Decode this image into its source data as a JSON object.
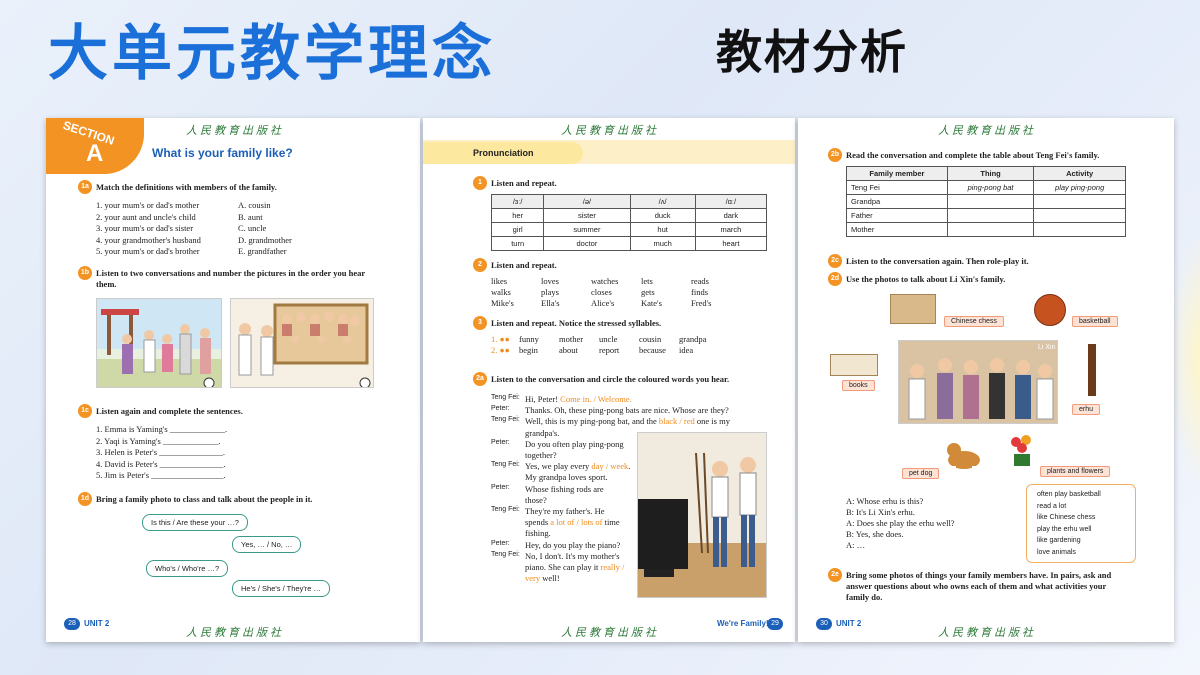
{
  "slide": {
    "title": "大单元教学理念",
    "subtitle": "教材分析"
  },
  "publisher": "人民教育出版社",
  "page1": {
    "section": {
      "word": "SECTION",
      "letter": "A",
      "title": "What is your family like?"
    },
    "ex1a": {
      "num": "1a",
      "instr": "Match the definitions with members of the family.",
      "items": [
        "1. your mum's or dad's mother",
        "2. your aunt and uncle's child",
        "3. your mum's or dad's sister",
        "4. your grandmother's husband",
        "5. your mum's or dad's brother"
      ],
      "options": [
        "A. cousin",
        "B. aunt",
        "C. uncle",
        "D. grandmother",
        "E. grandfather"
      ]
    },
    "ex1b": {
      "num": "1b",
      "instr1": "Listen to two conversations and number the pictures in the order you hear",
      "instr2": "them."
    },
    "ex1c": {
      "num": "1c",
      "instr": "Listen again and complete the sentences.",
      "items": [
        "1. Emma is Yaming's _____________.",
        "2. Yaqi is Yaming's _____________.",
        "3. Helen is Peter's _______________.",
        "4. David is Peter's _______________.",
        "5. Jim is Peter's _________________."
      ]
    },
    "ex1d": {
      "num": "1d",
      "instr": "Bring a family photo to class and talk about the people in it.",
      "bubbles": [
        "Is this / Are these your …?",
        "Yes, … / No, …",
        "Who's / Who're …?",
        "He's / She's / They're …"
      ]
    },
    "footer": {
      "page": "28",
      "unit": "UNIT 2"
    }
  },
  "page2": {
    "pron": "Pronunciation",
    "ex1": {
      "num": "1",
      "instr": "Listen and repeat.",
      "headers": [
        "/ɜː/",
        "/ə/",
        "/ʌ/",
        "/ɑː/"
      ],
      "rows": [
        [
          "her",
          "sister",
          "duck",
          "dark"
        ],
        [
          "girl",
          "summer",
          "hut",
          "march"
        ],
        [
          "turn",
          "doctor",
          "much",
          "heart"
        ]
      ]
    },
    "ex2": {
      "num": "2",
      "instr": "Listen and repeat.",
      "rows": [
        [
          "likes",
          "loves",
          "watches",
          "lets",
          "reads"
        ],
        [
          "walks",
          "plays",
          "closes",
          "gets",
          "finds"
        ],
        [
          "Mike's",
          "Ella's",
          "Alice's",
          "Kate's",
          "Fred's"
        ]
      ]
    },
    "ex3": {
      "num": "3",
      "instr": "Listen and repeat. Notice the stressed syllables.",
      "rows": [
        {
          "n": "1. ●●",
          "w": [
            "funny",
            "mother",
            "uncle",
            "cousin",
            "grandpa"
          ]
        },
        {
          "n": "2. ●●",
          "w": [
            "begin",
            "about",
            "report",
            "because",
            "idea"
          ]
        }
      ]
    },
    "ex2a": {
      "num": "2a",
      "instr": "Listen to the conversation and circle the coloured words you hear.",
      "lines": [
        {
          "sp": "Teng Fei:",
          "parts": [
            {
              "t": "Hi, Peter! "
            },
            {
              "t": "Come in. / Welcome.",
              "o": true
            }
          ]
        },
        {
          "sp": "Peter:",
          "parts": [
            {
              "t": "Thanks. Oh, these ping-pong bats are nice. Whose are they?"
            }
          ]
        },
        {
          "sp": "Teng Fei:",
          "parts": [
            {
              "t": "Well, this is my ping-pong bat, and the "
            },
            {
              "t": "black / red",
              "o": true
            },
            {
              "t": " one is my"
            }
          ]
        },
        {
          "sp": "",
          "parts": [
            {
              "t": "grandpa's."
            }
          ]
        },
        {
          "sp": "Peter:",
          "parts": [
            {
              "t": "Do you often play ping-pong"
            }
          ]
        },
        {
          "sp": "",
          "parts": [
            {
              "t": "together?"
            }
          ]
        },
        {
          "sp": "Teng Fei:",
          "parts": [
            {
              "t": "Yes, we play every "
            },
            {
              "t": "day / week",
              "o": true
            },
            {
              "t": "."
            }
          ]
        },
        {
          "sp": "",
          "parts": [
            {
              "t": "My grandpa loves sport."
            }
          ]
        },
        {
          "sp": "Peter:",
          "parts": [
            {
              "t": "Whose fishing rods are"
            }
          ]
        },
        {
          "sp": "",
          "parts": [
            {
              "t": "those?"
            }
          ]
        },
        {
          "sp": "Teng Fei:",
          "parts": [
            {
              "t": "They're my father's. He"
            }
          ]
        },
        {
          "sp": "",
          "parts": [
            {
              "t": "spends "
            },
            {
              "t": "a lot of / lots of",
              "o": true
            },
            {
              "t": " time"
            }
          ]
        },
        {
          "sp": "",
          "parts": [
            {
              "t": "fishing."
            }
          ]
        },
        {
          "sp": "Peter:",
          "parts": [
            {
              "t": "Hey, do you play the piano?"
            }
          ]
        },
        {
          "sp": "Teng Fei:",
          "parts": [
            {
              "t": "No, I don't. It's my mother's"
            }
          ]
        },
        {
          "sp": "",
          "parts": [
            {
              "t": "piano. She can play it "
            },
            {
              "t": "really /",
              "o": true
            }
          ]
        },
        {
          "sp": "",
          "parts": [
            {
              "t": "very",
              "o": true
            },
            {
              "t": " well!"
            }
          ]
        }
      ]
    },
    "footer": {
      "page": "29",
      "title": "We're Family!"
    }
  },
  "page3": {
    "ex2b": {
      "num": "2b",
      "instr": "Read the conversation and complete the table about Teng Fei's family.",
      "headers": [
        "Family member",
        "Thing",
        "Activity"
      ],
      "rows": [
        [
          "Teng Fei",
          "ping-pong bat",
          "play ping-pong"
        ],
        [
          "Grandpa",
          "",
          ""
        ],
        [
          "Father",
          "",
          ""
        ],
        [
          "Mother",
          "",
          ""
        ]
      ]
    },
    "ex2c": {
      "num": "2c",
      "instr": "Listen to the conversation again. Then role-play it."
    },
    "ex2d": {
      "num": "2d",
      "instr": "Use the photos to talk about Li Xin's family.",
      "labels": {
        "chess": "Chinese chess",
        "basketball": "basketball",
        "books": "books",
        "erhu": "erhu",
        "petdog": "pet dog",
        "plants": "plants and flowers",
        "lixin": "Li Xin"
      },
      "dialog": [
        "A: Whose erhu is this?",
        "B: It's Li Xin's erhu.",
        "A: Does she play the erhu well?",
        "B: Yes, she does.",
        "A: …"
      ],
      "activities": [
        "often play basketball",
        "read a lot",
        "like Chinese chess",
        "play the erhu well",
        "like gardening",
        "love animals"
      ]
    },
    "ex2e": {
      "num": "2e",
      "lines": [
        "Bring some photos of things your family members have. In pairs, ask and",
        "answer questions about who owns each of them and what activities your",
        "family do."
      ]
    },
    "footer": {
      "page": "30",
      "unit": "UNIT 2"
    }
  }
}
